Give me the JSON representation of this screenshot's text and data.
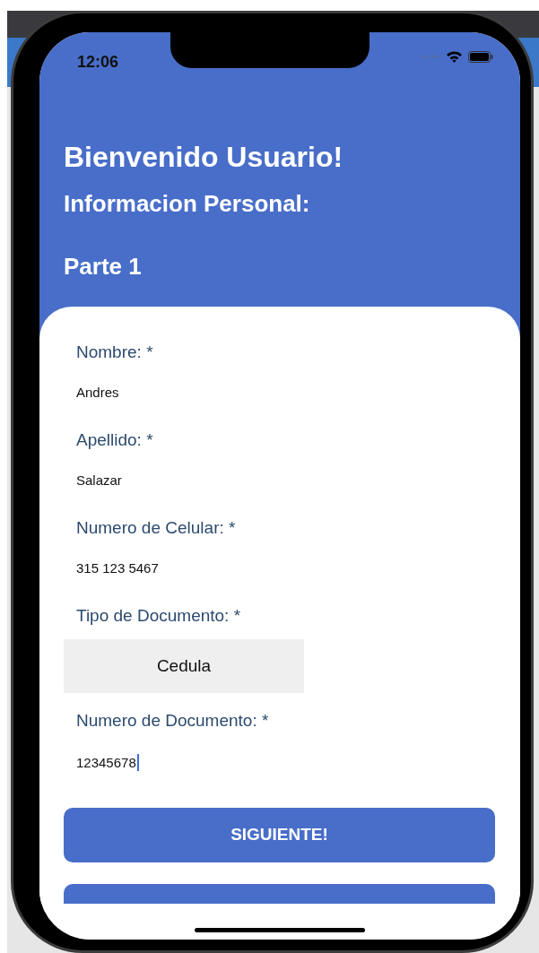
{
  "status_bar": {
    "time": "12:06"
  },
  "header": {
    "title": "Bienvenido Usuario!",
    "subtitle": "Informacion Personal:",
    "step": "Parte 1"
  },
  "fields": [
    {
      "kind": "text",
      "label": "Nombre: *",
      "value": "Andres",
      "focused": false
    },
    {
      "kind": "text",
      "label": "Apellido: *",
      "value": "Salazar",
      "focused": false
    },
    {
      "kind": "text",
      "label": "Numero de Celular: *",
      "value": "315 123 5467",
      "focused": false
    },
    {
      "kind": "select",
      "label": "Tipo de Documento: *",
      "value": "Cedula",
      "focused": false
    },
    {
      "kind": "text",
      "label": "Numero de Documento: *",
      "value": "12345678",
      "focused": true
    }
  ],
  "buttons": [
    {
      "label": "SIGUIENTE!"
    }
  ]
}
